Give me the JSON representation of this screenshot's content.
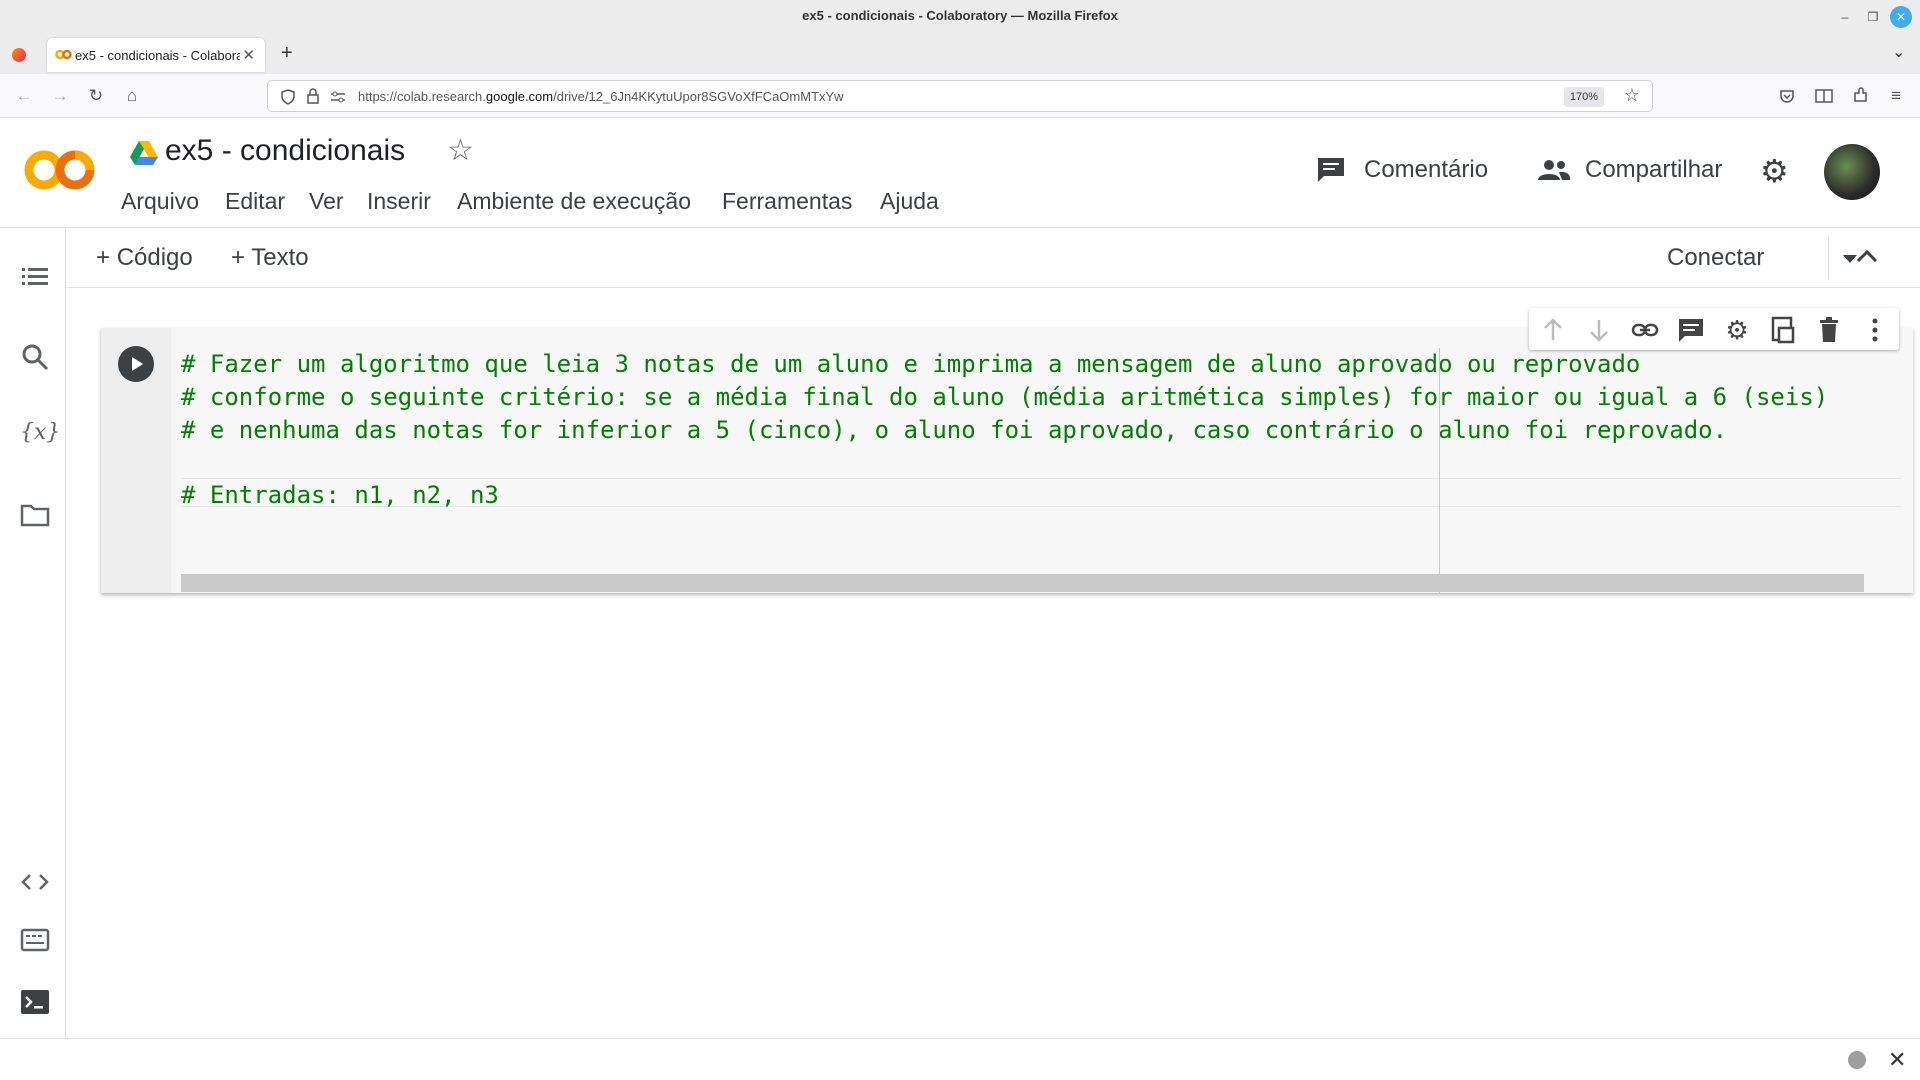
{
  "browser": {
    "window_title": "ex5 - condicionais - Colaboratory — Mozilla Firefox",
    "tab_label": "ex5 - condicionais - Colabora",
    "url_prefix": "https://colab.research.",
    "url_domain": "google.com",
    "url_path": "/drive/12_6Jn4KKytuUpor8SGVoXfFCaOmMTxYw",
    "zoom": "170%"
  },
  "header": {
    "title": "ex5 - condicionais",
    "menu": [
      "Arquivo",
      "Editar",
      "Ver",
      "Inserir",
      "Ambiente de execução",
      "Ferramentas",
      "Ajuda"
    ],
    "comment_label": "Comentário",
    "share_label": "Compartilhar"
  },
  "toolbar": {
    "add_code": "Código",
    "add_text": "Texto",
    "connect": "Conectar"
  },
  "cell": {
    "lines": [
      "# Fazer um algoritmo que leia 3 notas de um aluno e imprima a mensagem de aluno aprovado ou reprovado",
      "# conforme o seguinte critério: se a média final do aluno (média aritmética simples) for maior ou igual a 6 (seis)",
      "# e nenhuma das notas for inferior a 5 (cinco), o aluno foi aprovado, caso contrário o aluno foi reprovado.",
      "",
      "# Entradas: n1, n2, n3"
    ]
  },
  "colors": {
    "colab_orange": "#F9AB00",
    "colab_orange_dark": "#E8710A",
    "comment_green": "#008000"
  }
}
